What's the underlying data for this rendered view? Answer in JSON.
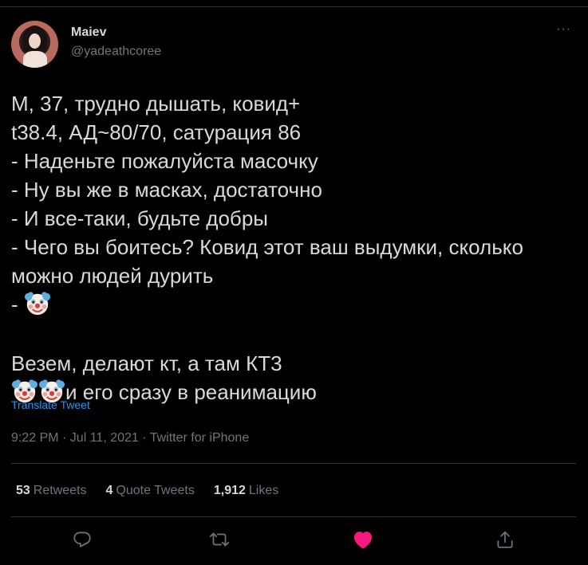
{
  "author": {
    "name": "Maiev",
    "handle": "@yadeathcoree"
  },
  "tweet": {
    "lines": [
      "М, 37, трудно дышать, ковид+",
      "t38.4, АД~80/70, сатурация 86",
      "- Наденьте пожалуйста масочку",
      "- Ну вы же в масках, достаточно",
      "- И все-таки, будьте добры",
      "- Чего вы боитесь? Ковид этот ваш выдумки, сколько",
      "можно людей дурить",
      "-",
      "",
      "Везем, делают кт, а там КТ3",
      "и его сразу в реанимацию"
    ]
  },
  "translate_label": "Translate Tweet",
  "meta": "9:22 PM · Jul 11, 2021 · Twitter for iPhone",
  "stats": {
    "retweets_count": "53",
    "retweets_label": "Retweets",
    "quotes_count": "4",
    "quotes_label": "Quote Tweets",
    "likes_count": "1,912",
    "likes_label": "Likes"
  },
  "icons": {
    "reply": "reply-icon",
    "retweet": "retweet-icon",
    "like": "heart-icon",
    "share": "share-icon",
    "clown": "clown-face-emoji"
  },
  "colors": {
    "background": "#000000",
    "text": "#d9d9d9",
    "muted": "#6e767d",
    "link": "#1d9bf0",
    "like": "#f91880",
    "divider": "#2f3336"
  }
}
